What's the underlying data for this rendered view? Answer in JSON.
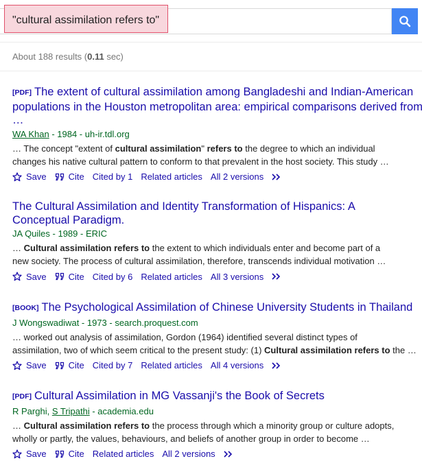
{
  "search": {
    "query": "\"cultural assimilation refers to\""
  },
  "stats": {
    "prefix": "About 188 results (",
    "time": "0.11",
    "suffix": " sec)"
  },
  "results": [
    {
      "tag": "[PDF]",
      "title": "The extent of cultural assimilation among Bangladeshi and Indian-American populations in the Houston metropolitan area: empirical comparisons derived from …",
      "authors_link": "WA Khan",
      "source": " - 1984 - uh-ir.tdl.org",
      "snippet1_a": "… The concept \"extent of ",
      "snippet1_b": "cultural assimilation",
      "snippet1_c": "\" ",
      "snippet1_d": "refers to",
      "snippet1_e": " the degree to which an individual",
      "snippet2": "changes his native cultural pattern to conform to that prevalent in the host society. This study …",
      "save": "Save",
      "cite": "Cite",
      "cited_by": "Cited by 1",
      "related": "Related articles",
      "versions": "All 2 versions"
    },
    {
      "title": "The Cultural Assimilation and Identity Transformation of Hispanics: A Conceptual Paradigm.",
      "authors": "JA Quiles - 1989 - ERIC",
      "snippet1_a": "… ",
      "snippet1_b": "Cultural assimilation refers to",
      "snippet1_c": " the extent to which individuals enter and become part of a",
      "snippet2": "new society. The process of cultural assimilation, therefore, transcends individual motivation …",
      "save": "Save",
      "cite": "Cite",
      "cited_by": "Cited by 6",
      "related": "Related articles",
      "versions": "All 3 versions"
    },
    {
      "tag": "[BOOK]",
      "title": "The Psychological Assimilation of Chinese University Students in Thailand",
      "authors": "J Wongswadiwat - 1973 - search.proquest.com",
      "snippet1": "… worked out analysis of assimilation, Gordon (1964) identified several distinct types of",
      "snippet2_a": "assimilation, two of which seem critical to the present study: (1) ",
      "snippet2_b": "Cultural assimilation refers to",
      "snippet2_c": " the …",
      "save": "Save",
      "cite": "Cite",
      "cited_by": "Cited by 7",
      "related": "Related articles",
      "versions": "All 4 versions"
    },
    {
      "tag": "[PDF]",
      "title": "Cultural Assimilation in MG Vassanji's the Book of Secrets",
      "author1": "R Parghi",
      "sep": ", ",
      "author2": "S Tripathi",
      "source": " - academia.edu",
      "snippet1_a": "… ",
      "snippet1_b": "Cultural assimilation refers to",
      "snippet1_c": " the process through which a minority group or culture adopts,",
      "snippet2": "wholly or partly, the values, behaviours, and beliefs of another group in order to become …",
      "save": "Save",
      "cite": "Cite",
      "related": "Related articles",
      "versions": "All 2 versions"
    }
  ],
  "icons": {
    "search": "search-icon",
    "save": "star-icon",
    "cite": "quote-icon",
    "more": "double-chevron-icon"
  },
  "colors": {
    "link": "#1a0dab",
    "source": "#006621",
    "search_button": "#4285f4",
    "highlight_border": "#e0506a"
  }
}
